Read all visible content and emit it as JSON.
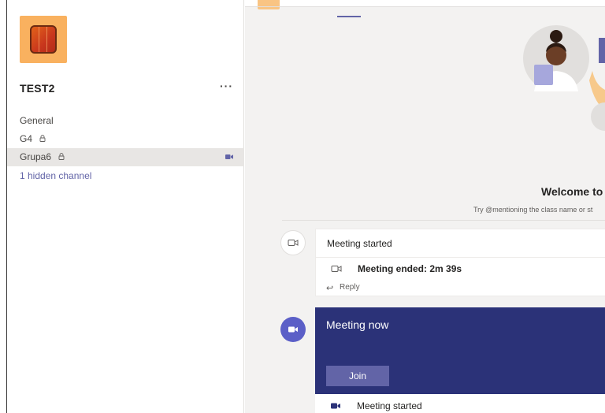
{
  "team": {
    "name": "TEST2",
    "more_label": "···",
    "tile_color": "#f9b15f"
  },
  "channels": [
    {
      "label": "General",
      "locked": false
    },
    {
      "label": "G4",
      "locked": true
    },
    {
      "label": "Grupa6",
      "locked": true,
      "active": true,
      "meeting_live": true
    }
  ],
  "hidden_channels": "1 hidden channel",
  "welcome": {
    "title": "Welcome to",
    "subtitle": "Try @mentioning the class name or st"
  },
  "posts": [
    {
      "title": "Meeting started",
      "sub": "Meeting ended: 2m 39s",
      "reply": "Reply"
    },
    {
      "title": "Meeting now",
      "button": "Join",
      "footer": "Meeting started"
    }
  ],
  "colors": {
    "accent": "#6264a7",
    "meeting_banner": "#2b3278"
  }
}
